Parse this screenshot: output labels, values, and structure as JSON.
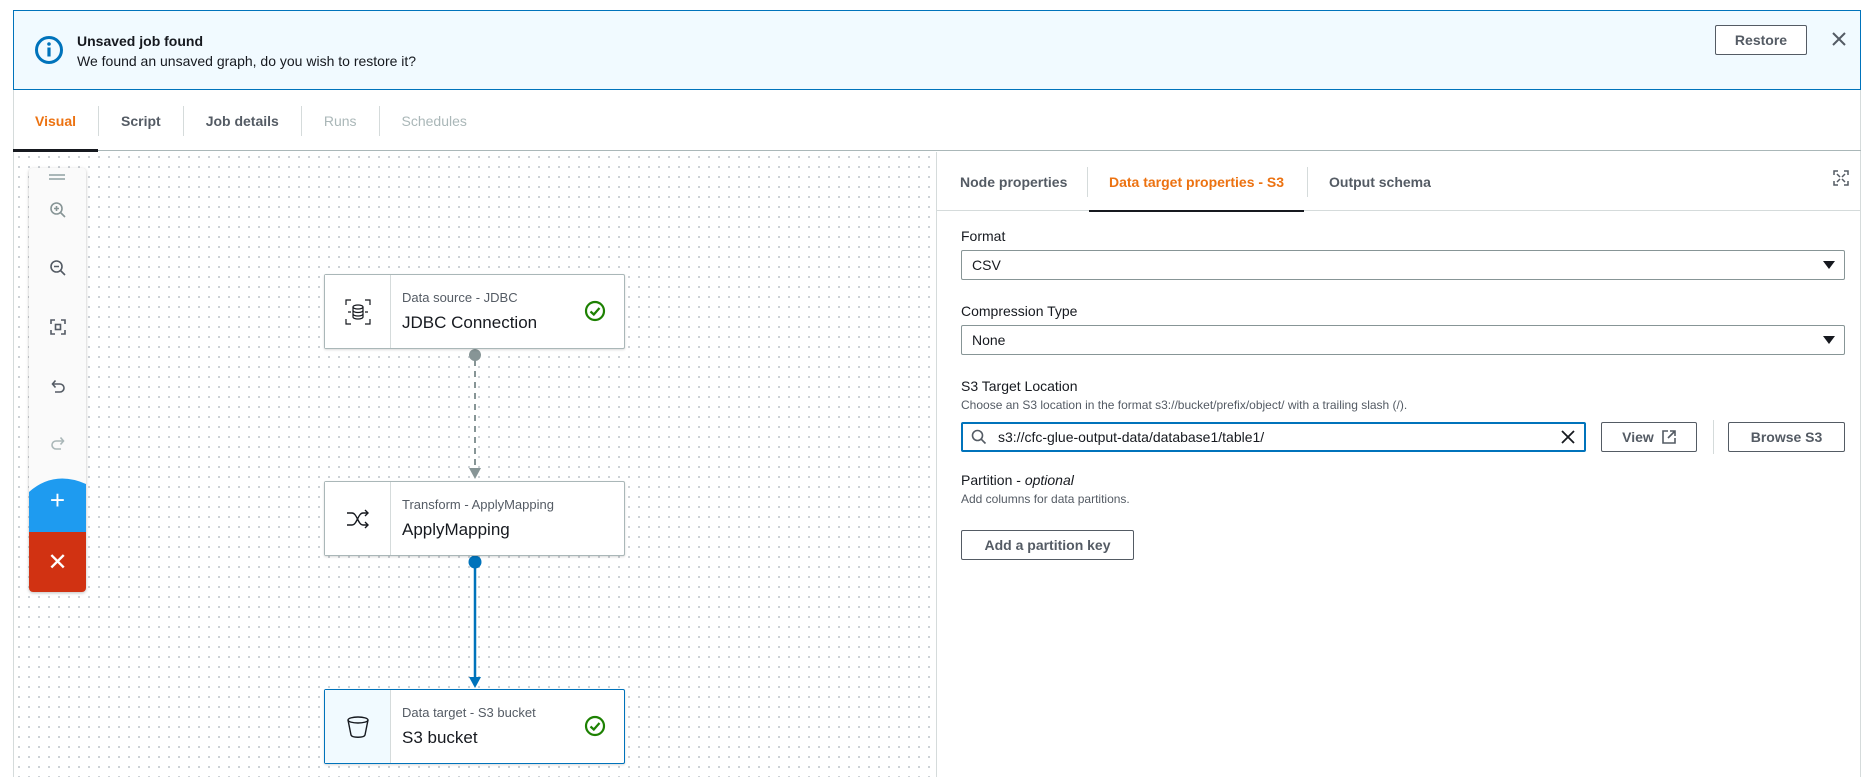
{
  "banner": {
    "title": "Unsaved job found",
    "message": "We found an unsaved graph, do you wish to restore it?",
    "restore_label": "Restore"
  },
  "tabs": [
    {
      "label": "Visual",
      "state": "active"
    },
    {
      "label": "Script",
      "state": "normal"
    },
    {
      "label": "Job details",
      "state": "normal"
    },
    {
      "label": "Runs",
      "state": "disabled"
    },
    {
      "label": "Schedules",
      "state": "disabled"
    }
  ],
  "graph": {
    "nodes": [
      {
        "type_label": "Data source - JDBC",
        "name": "JDBC Connection",
        "icon": "database-icon",
        "status": "check-circle-icon"
      },
      {
        "type_label": "Transform - ApplyMapping",
        "name": "ApplyMapping",
        "icon": "shuffle-icon"
      },
      {
        "type_label": "Data target - S3 bucket",
        "name": "S3 bucket",
        "icon": "bucket-icon",
        "status": "check-circle-icon",
        "selected": true
      }
    ]
  },
  "toolbar": {
    "tools": [
      "zoom-in-icon",
      "zoom-out-icon",
      "fit-view-icon",
      "undo-icon",
      "redo-icon"
    ],
    "add_symbol": "+",
    "remove_symbol": "✕"
  },
  "panel": {
    "tabs": [
      {
        "label": "Node properties",
        "state": "normal"
      },
      {
        "label": "Data target properties - S3",
        "state": "active"
      },
      {
        "label": "Output schema",
        "state": "normal"
      }
    ],
    "format": {
      "label": "Format",
      "value": "CSV"
    },
    "compression": {
      "label": "Compression Type",
      "value": "None"
    },
    "s3_location": {
      "label": "S3 Target Location",
      "description": "Choose an S3 location in the format s3://bucket/prefix/object/ with a trailing slash (/).",
      "value": "s3://cfc-glue-output-data/database1/table1/",
      "view_label": "View",
      "browse_label": "Browse S3"
    },
    "partition": {
      "label": "Partition - ",
      "label_optional": "optional",
      "description": "Add columns for data partitions.",
      "add_label": "Add a partition key"
    }
  },
  "colors": {
    "accent": "#ec7211",
    "info_blue": "#0073bb",
    "add_blue": "#1e9bf0",
    "remove_red": "#d13212",
    "success_green": "#1d8102"
  }
}
